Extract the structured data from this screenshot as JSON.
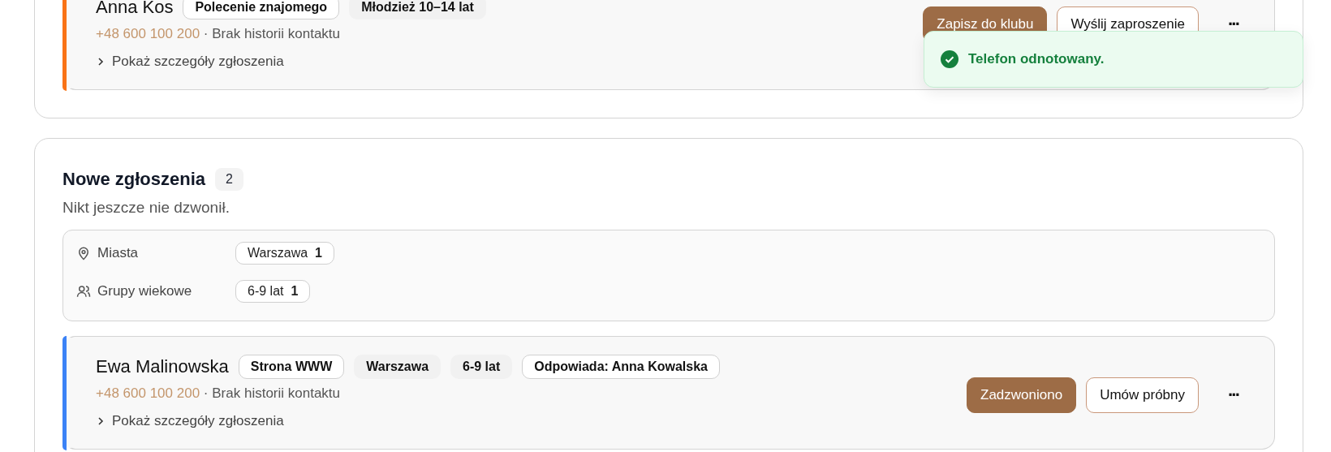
{
  "sections": [
    {
      "leads": [
        {
          "name": "Anna Kos",
          "color": "#f97316",
          "phone": "+48 600 100 200",
          "separator": "·",
          "history": "Brak historii kontaktu",
          "details_label": "Pokaż szczegóły zgłoszenia",
          "expanded": false,
          "chips": [
            {
              "kind": "outlined",
              "label": "Polecenie znajomego"
            },
            {
              "kind": "plain",
              "label": "Młodzież 10–14 lat"
            }
          ],
          "actions": [
            {
              "kind": "primary",
              "label": "Zapisz do klubu"
            },
            {
              "kind": "secondary",
              "label": "Wyślij zaproszenie"
            },
            {
              "kind": "more",
              "label": "···"
            }
          ]
        }
      ]
    },
    {
      "title": "Nowe zgłoszenia",
      "count": "2",
      "subtitle": "Nikt jeszcze nie dzwonił.",
      "filters": [
        {
          "kind": "cities",
          "label": "Miasta",
          "options": [
            {
              "label": "Warszawa",
              "count": "1"
            }
          ]
        },
        {
          "kind": "ages",
          "label": "Grupy wiekowe",
          "options": [
            {
              "label": "6-9 lat",
              "count": "1"
            }
          ]
        }
      ],
      "leads": [
        {
          "name": "Ewa Malinowska",
          "color": "#3b82f6",
          "phone": "+48 600 100 200",
          "separator": "·",
          "history": "Brak historii kontaktu",
          "details_label": "Pokaż szczegóły zgłoszenia",
          "expanded": false,
          "chips": [
            {
              "kind": "outlined",
              "label": "Strona WWW"
            },
            {
              "kind": "plain",
              "label": "Warszawa"
            },
            {
              "kind": "plain",
              "label": "6-9 lat"
            },
            {
              "kind": "outlined",
              "label": "Odpowiada: Anna Kowalska"
            }
          ],
          "actions": [
            {
              "kind": "primary",
              "label": "Zadzwoniono"
            },
            {
              "kind": "secondary",
              "label": "Umów próbny"
            },
            {
              "kind": "more",
              "label": "···"
            }
          ]
        }
      ]
    }
  ],
  "toast": {
    "kind": "success",
    "text": "Telefon odnotowany."
  }
}
